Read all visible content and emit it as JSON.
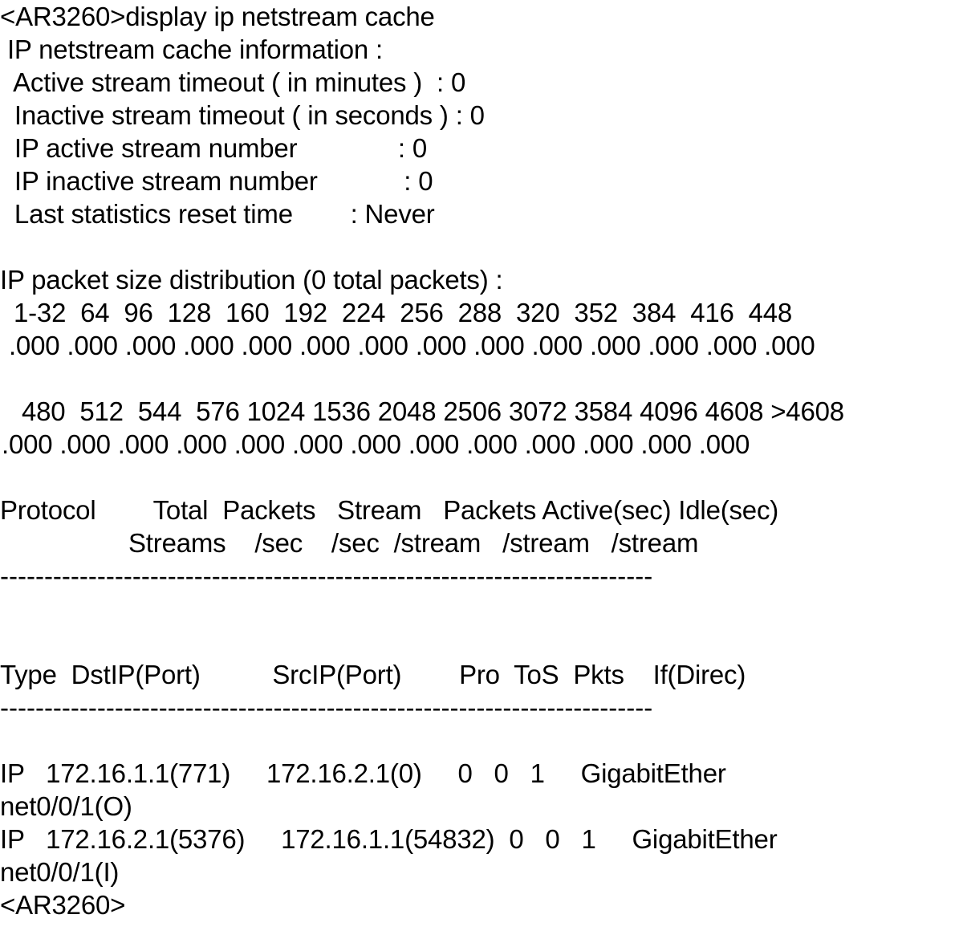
{
  "terminal": {
    "device_prompt": "<AR3260>",
    "command_line": "<AR3260>display ip netstream cache",
    "command": "display ip netstream cache",
    "trailing_prompt": "<AR3260>"
  },
  "cache_info": {
    "title": " IP netstream cache information :",
    "rows": [
      {
        "label": "  Active stream timeout ( in minutes )",
        "separator": "  : ",
        "value": "0",
        "text": "  Active stream timeout ( in minutes )  : 0"
      },
      {
        "label": "  Inactive stream timeout ( in seconds )",
        "separator": " : ",
        "value": "0",
        "text": "  Inactive stream timeout ( in seconds ) : 0"
      },
      {
        "label": "  IP active stream number",
        "separator": "             : ",
        "value": "0",
        "text": "  IP active stream number              : 0"
      },
      {
        "label": "  IP inactive stream number",
        "separator": "           : ",
        "value": "0",
        "text": "  IP inactive stream number            : 0"
      },
      {
        "label": "  Last statistics reset time",
        "separator": "         : ",
        "value": "Never",
        "text": "  Last statistics reset time        : Never"
      }
    ]
  },
  "packet_distribution": {
    "title": "IP packet size distribution (0 total packets) :",
    "total_packets": "0",
    "block1": {
      "buckets_text": " 1-32  64  96  128  160  192  224  256  288  320  352  384  416  448",
      "values_text": " .000 .000 .000 .000 .000 .000 .000 .000 .000 .000 .000 .000 .000 .000",
      "buckets": [
        "1-32",
        "64",
        "96",
        "128",
        "160",
        "192",
        "224",
        "256",
        "288",
        "320",
        "352",
        "384",
        "416",
        "448"
      ],
      "values": [
        ".000",
        ".000",
        ".000",
        ".000",
        ".000",
        ".000",
        ".000",
        ".000",
        ".000",
        ".000",
        ".000",
        ".000",
        ".000",
        ".000"
      ]
    },
    "block2": {
      "buckets_text": " 480  512  544  576 1024 1536 2048 2506 3072 3584 4096 4608 >4608",
      "values_text": ".000 .000 .000 .000 .000 .000 .000 .000 .000 .000 .000 .000 .000",
      "buckets": [
        "480",
        "512",
        "544",
        "576",
        "1024",
        "1536",
        "2048",
        "2506",
        "3072",
        "3584",
        "4096",
        "4608",
        ">4608"
      ],
      "values": [
        ".000",
        ".000",
        ".000",
        ".000",
        ".000",
        ".000",
        ".000",
        ".000",
        ".000",
        ".000",
        ".000",
        ".000",
        ".000"
      ]
    }
  },
  "protocol_table": {
    "header_line1": "Protocol        Total  Packets   Stream   Packets Active(sec) Idle(sec)",
    "header_line2": "Streams    /sec    /sec  /stream   /stream   /stream",
    "header1_cells": [
      "Protocol",
      "Total",
      "Packets",
      "Stream",
      "Packets",
      "Active(sec)",
      "Idle(sec)"
    ],
    "header2_cells": [
      "Streams",
      "/sec",
      "/sec",
      "/stream",
      "/stream",
      "/stream"
    ],
    "separator": "--------------------------------------------------------------------------",
    "rows": []
  },
  "flow_table": {
    "header_line": "Type  DstIP(Port)          SrcIP(Port)        Pro  ToS  Pkts    If(Direc)",
    "header_cells": [
      "Type",
      "DstIP(Port)",
      "SrcIP(Port)",
      "Pro",
      "ToS",
      "Pkts",
      "If(Direc)"
    ],
    "separator": "--------------------------------------------------------------------------",
    "rows": [
      {
        "type": "IP",
        "dst": "172.16.1.1(771)",
        "src": "172.16.2.1(0)",
        "pro": "0",
        "tos": "0",
        "pkts": "1",
        "interface": "GigabitEthernet0/0/1(O)",
        "line_main": "IP   172.16.1.1(771)     172.16.2.1(0)     0   0   1     GigabitEther",
        "line_wrap": "net0/0/1(O)"
      },
      {
        "type": "IP",
        "dst": "172.16.2.1(5376)",
        "src": "172.16.1.1(54832)",
        "pro": "0",
        "tos": "0",
        "pkts": "1",
        "interface": "GigabitEthernet0/0/1(I)",
        "line_main": "IP   172.16.2.1(5376)     172.16.1.1(54832)  0   0   1     GigabitEther",
        "line_wrap": "net0/0/1(I)"
      }
    ]
  },
  "colors": {
    "background": "#ffffff",
    "text": "#000000"
  }
}
